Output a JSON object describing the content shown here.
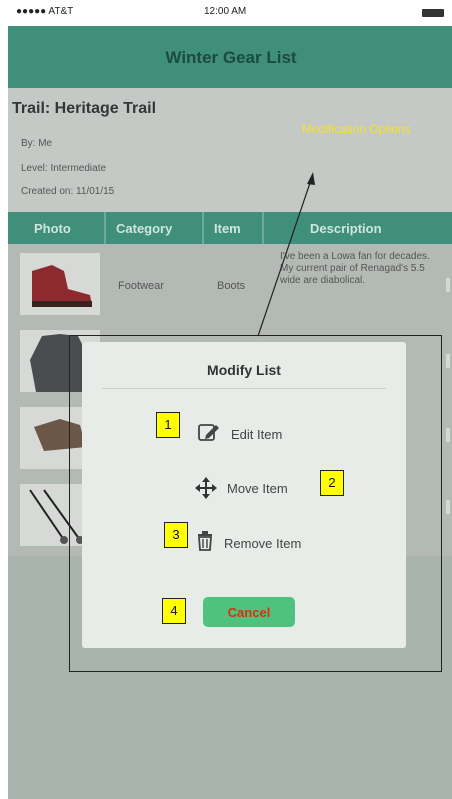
{
  "status": {
    "carrier": "●●●●● AT&T",
    "time": "12:00 AM"
  },
  "header": {
    "title": "Winter Gear List"
  },
  "trail": {
    "name": "Trail:  Heritage Trail",
    "by": "By: Me",
    "level": "Level: Intermediate",
    "created": "Created on:  11/01/15"
  },
  "annotation": {
    "modification_options": "Modification Options"
  },
  "table": {
    "columns": [
      "Photo",
      "Category",
      "Item",
      "Description"
    ],
    "rows": [
      {
        "photo_icon": "boot-photo",
        "category": "Footwear",
        "item": "Boots",
        "description": "I've been a Lowa fan for decades. My current pair of Renagad's 5.5 wide are diabolical."
      },
      {
        "photo_icon": "jacket-photo"
      },
      {
        "photo_icon": "gloves-photo"
      },
      {
        "photo_icon": "poles-photo"
      }
    ]
  },
  "modal": {
    "title": "Modify List",
    "edit_label": "Edit Item",
    "move_label": "Move Item",
    "remove_label": "Remove Item",
    "cancel_label": "Cancel",
    "callouts": [
      "1",
      "2",
      "3",
      "4"
    ]
  },
  "colors": {
    "accent": "#3f8f7b",
    "callout": "#ffff00",
    "cancel_bg": "#4ec27e",
    "cancel_text": "#d9310b"
  }
}
